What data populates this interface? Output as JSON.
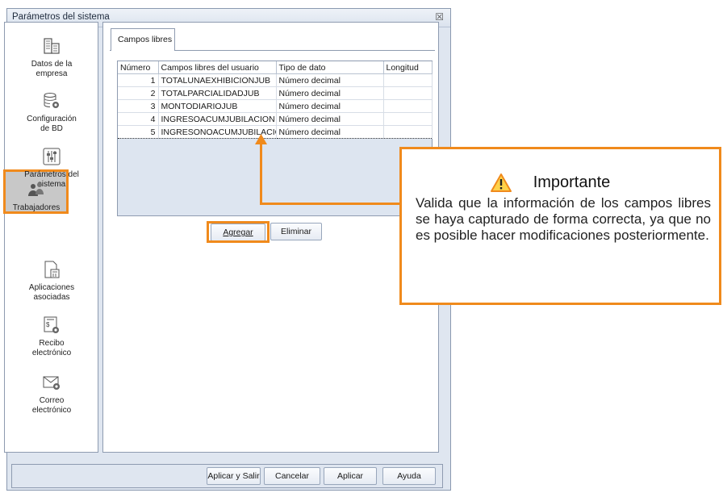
{
  "window": {
    "title": "Parámetros del sistema",
    "close_symbol": "☒"
  },
  "sidebar": {
    "items": [
      {
        "label": "Datos de la\nempresa",
        "icon": "building-icon"
      },
      {
        "label": "Configuración\nde BD",
        "icon": "database-gear-icon"
      },
      {
        "label": "Parámetros del\nsistema",
        "icon": "sliders-icon"
      },
      {
        "label": "Trabajadores",
        "icon": "workers-icon",
        "selected": true
      },
      {
        "label": "Aplicaciones\nasociadas",
        "icon": "document-calculator-icon"
      },
      {
        "label": "Recibo\nelectrónico",
        "icon": "receipt-gear-icon"
      },
      {
        "label": "Correo\nelectrónico",
        "icon": "mail-gear-icon"
      }
    ]
  },
  "tab": {
    "label": "Campos libres"
  },
  "grid": {
    "columns": [
      "Número",
      "Campos libres del usuario",
      "Tipo de dato",
      "Longitud"
    ],
    "rows": [
      {
        "num": "1",
        "campo": "TOTALUNAEXHIBICIONJUB",
        "tipo": "Número decimal",
        "longitud": ""
      },
      {
        "num": "2",
        "campo": "TOTALPARCIALIDADJUB",
        "tipo": "Número decimal",
        "longitud": ""
      },
      {
        "num": "3",
        "campo": "MONTODIARIOJUB",
        "tipo": "Número decimal",
        "longitud": ""
      },
      {
        "num": "4",
        "campo": "INGRESOACUMJUBILACION",
        "tipo": "Número decimal",
        "longitud": ""
      },
      {
        "num": "5",
        "campo": "INGRESONOACUMJUBILACION",
        "tipo": "Número decimal",
        "longitud": ""
      }
    ]
  },
  "actions": {
    "agregar": "Agregar",
    "eliminar": "Eliminar"
  },
  "footer": {
    "aplicar_salir": "Aplicar y Salir",
    "cancelar": "Cancelar",
    "aplicar": "Aplicar",
    "ayuda": "Ayuda"
  },
  "callout": {
    "title": "Importante",
    "body": "Valida que la información de los campos libres se haya capturado de forma correcta, ya que no es posible hacer modificaciones posteriormente.",
    "accent": "#f08a1c"
  }
}
